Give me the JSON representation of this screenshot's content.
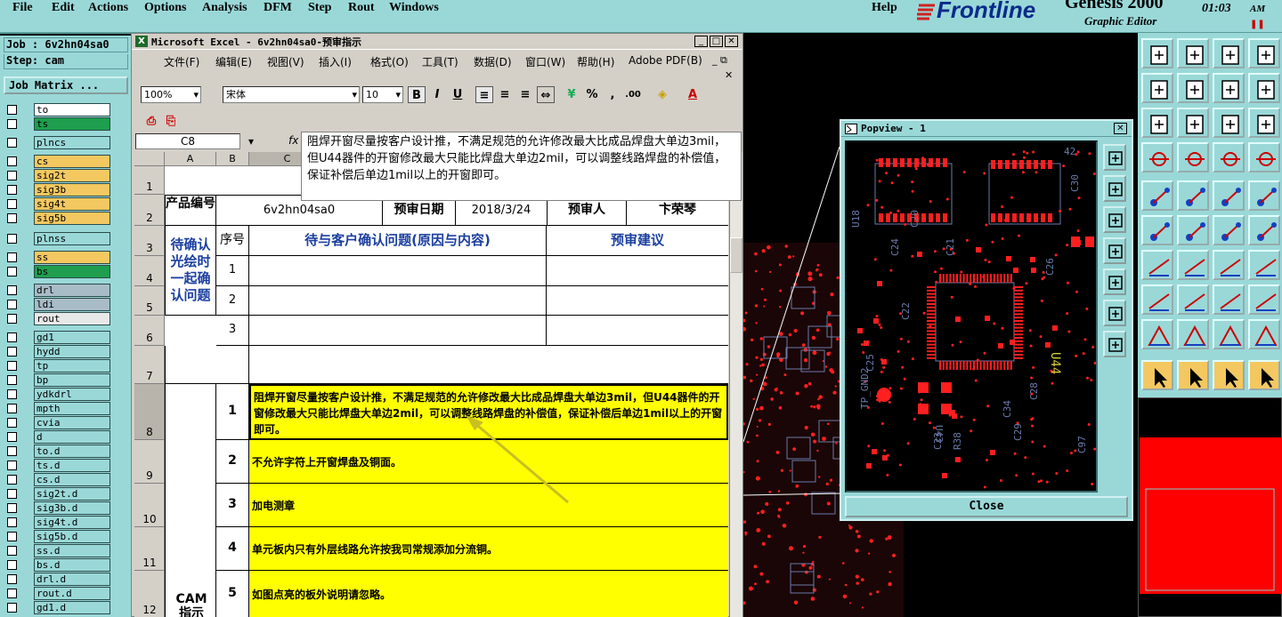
{
  "menubar": {
    "items": [
      "File",
      "Edit",
      "Actions",
      "Options",
      "Analysis",
      "DFM",
      "Step",
      "Rout",
      "Windows"
    ],
    "help": "Help"
  },
  "brand": {
    "logo": "Frontline",
    "product": "Genesis 2000",
    "subtitle": "Graphic Editor",
    "clock": "01:03",
    "ampm": "AM"
  },
  "left": {
    "job_label": "Job : 6v2hn04sa0",
    "step_label": "Step: cam",
    "job_matrix": "Job Matrix ...",
    "layers": [
      {
        "name": "to",
        "color": "#ffffff"
      },
      {
        "name": "ts",
        "color": "#1e9e4e"
      },
      {
        "name": "plncs",
        "color": "#9ad8d8"
      },
      {
        "name": "cs",
        "color": "#f4c860"
      },
      {
        "name": "sig2t",
        "color": "#f4c860"
      },
      {
        "name": "sig3b",
        "color": "#f4c860"
      },
      {
        "name": "sig4t",
        "color": "#f4c860"
      },
      {
        "name": "sig5b",
        "color": "#f4c860"
      },
      {
        "name": "plnss",
        "color": "#9ad8d8"
      },
      {
        "name": "ss",
        "color": "#f4c860"
      },
      {
        "name": "bs",
        "color": "#1e9e4e"
      },
      {
        "name": "drl",
        "color": "#a8bcc8"
      },
      {
        "name": "ldi",
        "color": "#a8bcc8"
      },
      {
        "name": "rout",
        "color": "#e8e8e8"
      },
      {
        "name": "gd1",
        "color": "#9ad8d8"
      },
      {
        "name": "hydd",
        "color": "#9ad8d8"
      },
      {
        "name": "tp",
        "color": "#9ad8d8"
      },
      {
        "name": "bp",
        "color": "#9ad8d8"
      },
      {
        "name": "ydkdrl",
        "color": "#9ad8d8"
      },
      {
        "name": "mpth",
        "color": "#9ad8d8"
      },
      {
        "name": "cvia",
        "color": "#9ad8d8"
      },
      {
        "name": "d",
        "color": "#9ad8d8"
      },
      {
        "name": "to.d",
        "color": "#9ad8d8"
      },
      {
        "name": "ts.d",
        "color": "#9ad8d8"
      },
      {
        "name": "cs.d",
        "color": "#9ad8d8"
      },
      {
        "name": "sig2t.d",
        "color": "#9ad8d8"
      },
      {
        "name": "sig3b.d",
        "color": "#9ad8d8"
      },
      {
        "name": "sig4t.d",
        "color": "#9ad8d8"
      },
      {
        "name": "sig5b.d",
        "color": "#9ad8d8"
      },
      {
        "name": "ss.d",
        "color": "#9ad8d8"
      },
      {
        "name": "bs.d",
        "color": "#9ad8d8"
      },
      {
        "name": "drl.d",
        "color": "#9ad8d8"
      },
      {
        "name": "rout.d",
        "color": "#9ad8d8"
      },
      {
        "name": "gd1.d",
        "color": "#9ad8d8"
      }
    ]
  },
  "excel": {
    "title": "Microsoft Excel - 6v2hn04sa0-预审指示",
    "menu": [
      "文件(F)",
      "编辑(E)",
      "视图(V)",
      "插入(I)",
      "格式(O)",
      "工具(T)",
      "数据(D)",
      "窗口(W)",
      "帮助(H)",
      "Adobe PDF(B)"
    ],
    "zoom": "100%",
    "font": "宋体",
    "font_size": "10",
    "name_box": "C8",
    "fx": "fx",
    "comment": "阻焊开窗尽量按客户设计推，不满足规范的允许修改最大比成品焊盘大单边3mil，但U44器件的开窗修改最大只能比焊盘大单边2mil，可以调整线路焊盘的补偿值，保证补偿后单边1mil以上的开窗即可。",
    "col_headers": [
      "A",
      "B",
      "C"
    ],
    "row_numbers": [
      "1",
      "2",
      "3",
      "4",
      "5",
      "6",
      "7",
      "8",
      "9",
      "10",
      "11",
      "12"
    ],
    "product_no_label": "产品编号",
    "product_no": "6v2hn04sa0",
    "review_date_label": "预审日期",
    "review_date": "2018/3/24",
    "reviewer_label": "预审人",
    "reviewer": "卞荣琴",
    "seq_label": "序号",
    "issues_label": "待与客户确认问题(原因与内容)",
    "advice_label": "预审建议",
    "pending_label": "待确认光绘时一起确认问题",
    "pending_rows": [
      "1",
      "2",
      "3"
    ],
    "cam_label": "CAM指示",
    "cam_rows": [
      {
        "n": "1",
        "text": "阻焊开窗尽量按客户设计推，不满足规范的允许修改最大比成品焊盘大单边3mil，但U44器件的开窗修改最大只能比焊盘大单边2mil，可以调整线路焊盘的补偿值，保证补偿后单边1mil以上的开窗即可。"
      },
      {
        "n": "2",
        "text": "不允许字符上开窗焊盘及铜面。"
      },
      {
        "n": "3",
        "text": "加电测章"
      },
      {
        "n": "4",
        "text": "单元板内只有外层线路允许按我司常规添加分流铜。"
      },
      {
        "n": "5",
        "text": "如图点亮的板外说明请忽略。"
      }
    ]
  },
  "popview": {
    "title": "Popview - 1",
    "close": "Close",
    "labels": [
      "U18",
      "C20",
      "C24",
      "C21",
      "C26",
      "C22",
      "C25",
      "U44",
      "U43",
      "TP_GND2",
      "C23",
      "R38",
      "C28",
      "C34",
      "C29",
      "C30",
      "C97",
      "42"
    ]
  },
  "colors": {
    "accent_teal": "#9ad8d8",
    "pcb_red": "#ff1f1f",
    "cell_yellow": "#ffff00",
    "excel_chrome": "#d4d0c8"
  }
}
